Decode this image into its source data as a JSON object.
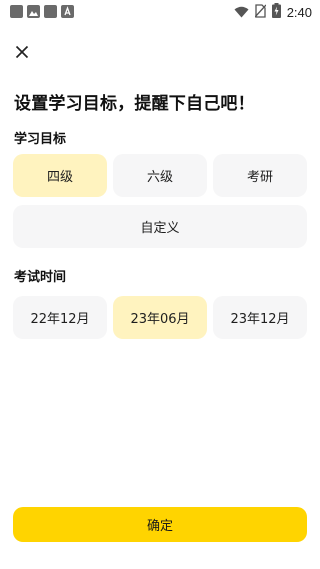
{
  "status_bar": {
    "time": "2:40",
    "icons": [
      "notification-icon",
      "gallery-icon",
      "notification-icon",
      "app-icon",
      "wifi-icon",
      "no-sim-icon",
      "battery-charging-icon"
    ]
  },
  "header": {
    "close_icon": "close-icon"
  },
  "page": {
    "title": "设置学习目标，提醒下自己吧！"
  },
  "goal_section": {
    "label": "学习目标",
    "options": [
      "四级",
      "六级",
      "考研"
    ],
    "custom_label": "自定义",
    "selected": "四级"
  },
  "exam_section": {
    "label": "考试时间",
    "options": [
      "22年12月",
      "23年06月",
      "23年12月"
    ],
    "selected": "23年06月"
  },
  "footer": {
    "confirm_label": "确定"
  },
  "colors": {
    "accent": "#ffd400",
    "selected_bg": "#fff3bf",
    "option_bg": "#f6f6f7"
  }
}
